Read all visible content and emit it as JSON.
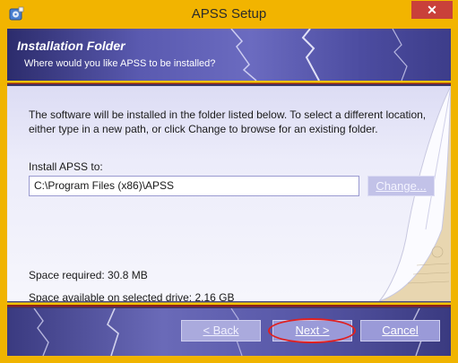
{
  "window": {
    "title": "APSS Setup",
    "close_label": "✕"
  },
  "header": {
    "title": "Installation Folder",
    "subtitle": "Where would you like APSS to be installed?"
  },
  "body": {
    "description": "The software will be installed in the folder listed below. To select a different location, either type in a new path, or click Change to browse for an existing folder.",
    "install_label": "Install APSS to:",
    "install_path": "C:\\Program Files (x86)\\APSS",
    "change_label": "Change...",
    "space_required": "Space required: 30.8 MB",
    "space_available": "Space available on selected drive: 2.16 GB"
  },
  "footer": {
    "back_label": "< Back",
    "next_label": "Next >",
    "cancel_label": "Cancel"
  },
  "colors": {
    "title_bar": "#f2b400",
    "close_button": "#c9403a",
    "header_bg": "#5a5ab0",
    "highlight": "#e02020"
  },
  "icons": {
    "app": "installer-icon",
    "close": "close-icon"
  }
}
